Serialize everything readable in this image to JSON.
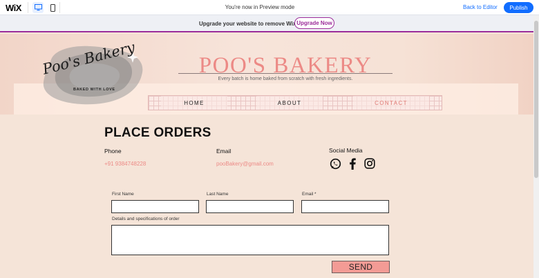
{
  "wix_bar": {
    "logo": "WiX",
    "preview_text": "You're now in Preview mode",
    "back_label": "Back to Editor",
    "publish_label": "Publish",
    "device_icons": [
      "desktop-icon",
      "mobile-icon"
    ]
  },
  "upgrade_banner": {
    "text": "Upgrade your website to remove Wix ads",
    "button_label": "Upgrade Now"
  },
  "header": {
    "logo_script": "Poo's Bakery",
    "logo_tagline": "BAKED WITH LOVE",
    "title": "POO'S BAKERY",
    "tagline": "Every batch is home baked from scratch with fresh ingredients."
  },
  "nav": {
    "items": [
      {
        "label": "HOME"
      },
      {
        "label": "ABOUT"
      },
      {
        "label": "CONTACT"
      }
    ]
  },
  "contact": {
    "title": "PLACE ORDERS",
    "phone_label": "Phone",
    "phone_value": "+91 9384748228",
    "email_label": "Email",
    "email_value": "pooBakery@gmail.com",
    "social_label": "Social Media",
    "social_icons": [
      "whatsapp-icon",
      "facebook-icon",
      "instagram-icon"
    ]
  },
  "form": {
    "first_name_label": "First Name",
    "last_name_label": "Last Name",
    "email_label": "Email *",
    "details_label": "Details and specifications of order",
    "send_label": "SEND"
  },
  "colors": {
    "accent_pink": "#ec8a86",
    "wix_blue": "#116dff",
    "banner_purple": "#9b2c9a",
    "page_bg": "#f5e4d8"
  }
}
